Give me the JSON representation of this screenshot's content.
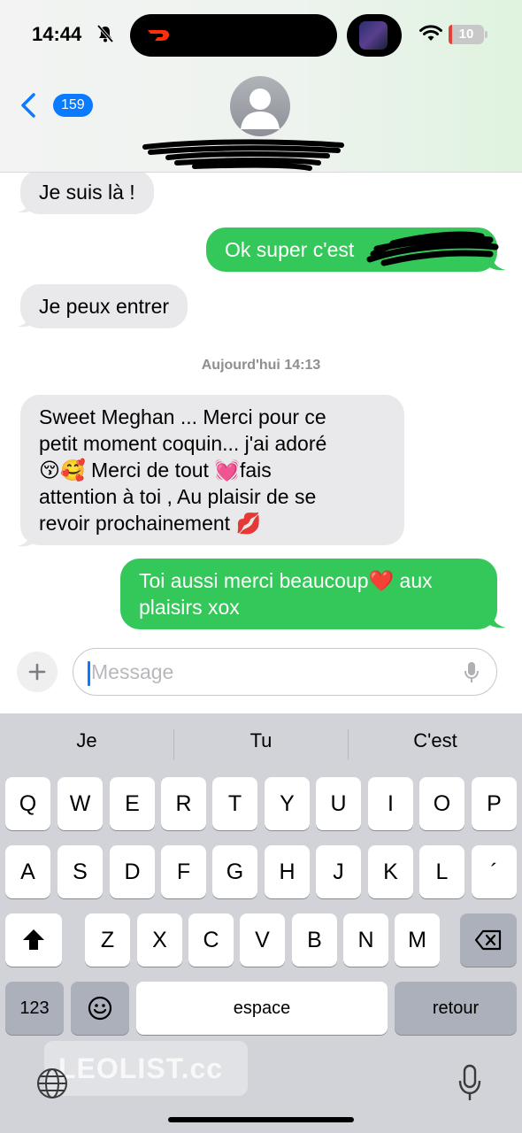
{
  "status_bar": {
    "time": "14:44",
    "battery": "10",
    "battery_level": 0.1
  },
  "header": {
    "back_count": "159"
  },
  "messages": [
    {
      "direction": "received",
      "text": "Je suis là !"
    },
    {
      "direction": "sent",
      "text": "Ok super c'est"
    },
    {
      "direction": "received",
      "text": "Je peux entrer"
    },
    {
      "direction": "received",
      "lines": [
        "Sweet Meghan ... Merci pour ce",
        "petit moment coquin... j'ai adoré",
        "😚🥰 Merci de tout 💓fais",
        "attention à toi , Au plaisir  de se",
        "revoir prochainement 💋"
      ]
    },
    {
      "direction": "sent",
      "lines": [
        "Toi aussi merci beaucoup❤️ aux",
        "plaisirs xox"
      ]
    }
  ],
  "timestamp": "Aujourd'hui 14:13",
  "composer": {
    "placeholder": "Message"
  },
  "keyboard": {
    "suggestions": [
      "Je",
      "Tu",
      "C'est"
    ],
    "row1": [
      "Q",
      "W",
      "E",
      "R",
      "T",
      "Y",
      "U",
      "I",
      "O",
      "P"
    ],
    "row2": [
      "A",
      "S",
      "D",
      "F",
      "G",
      "H",
      "J",
      "K",
      "L",
      "´"
    ],
    "row3": [
      "Z",
      "X",
      "C",
      "V",
      "B",
      "N",
      "M"
    ],
    "numbers_label": "123",
    "space_label": "espace",
    "return_label": "retour"
  },
  "watermark": "LEOLIST.cc",
  "colors": {
    "sent_bubble": "#34c759",
    "received_bubble": "#e9e9eb",
    "accent": "#0a7aff"
  }
}
